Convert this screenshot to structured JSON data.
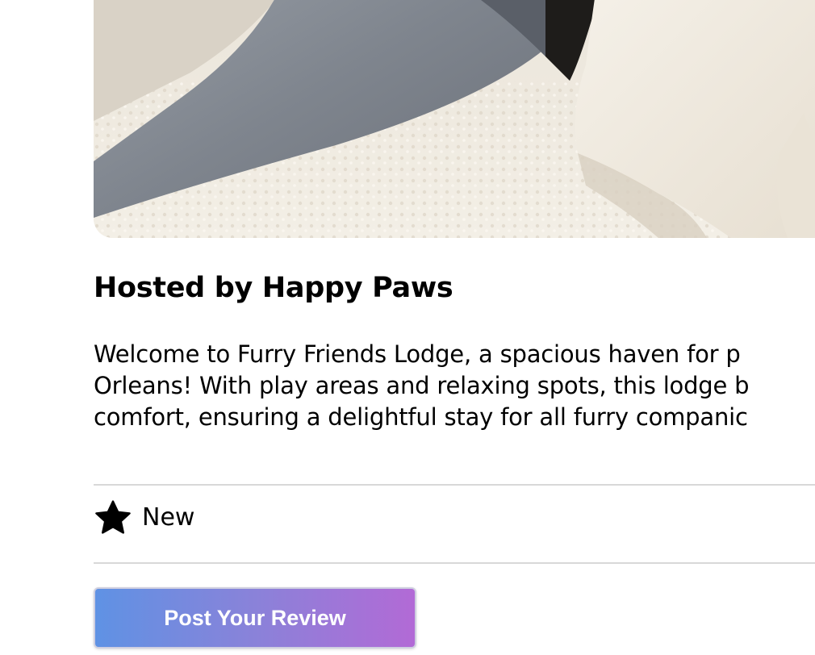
{
  "listing": {
    "host_title": "Hosted by Happy Paws",
    "description_lines": [
      "Welcome to Furry Friends Lodge, a spacious haven for p",
      "Orleans! With play areas and relaxing spots, this lodge b",
      "comfort, ensuring a delightful stay for all furry companic"
    ]
  },
  "rating": {
    "icon": "star-icon",
    "label": "New"
  },
  "actions": {
    "post_review_label": "Post Your Review",
    "gradient_start": "#5f92e4",
    "gradient_end": "#b26ad6"
  }
}
